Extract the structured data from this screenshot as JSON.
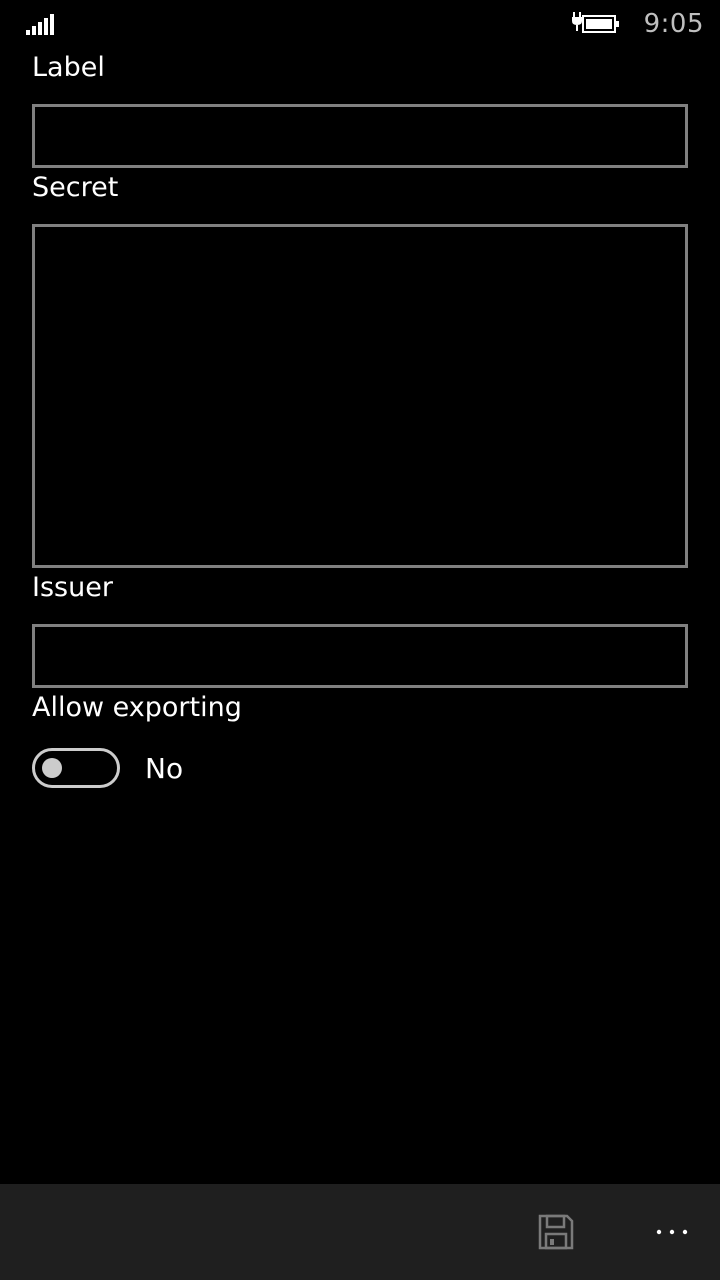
{
  "status_bar": {
    "time": "9:05",
    "signal_icon": "signal-bars-icon",
    "battery_icon": "battery-charging-icon"
  },
  "form": {
    "label": {
      "title": "Label",
      "value": "",
      "placeholder": ""
    },
    "secret": {
      "title": "Secret",
      "value": "",
      "placeholder": ""
    },
    "issuer": {
      "title": "Issuer",
      "value": "",
      "placeholder": ""
    },
    "allow_exporting": {
      "title": "Allow exporting",
      "state_text": "No",
      "on": false
    }
  },
  "app_bar": {
    "primary_icon": "save-icon",
    "more_icon": "more-ellipsis-icon"
  },
  "colors": {
    "background": "#000000",
    "input_border": "#808080",
    "app_bar": "#1f1f1f",
    "toggle_off": "#cccccc",
    "icon_gray": "#7a7a7a"
  }
}
